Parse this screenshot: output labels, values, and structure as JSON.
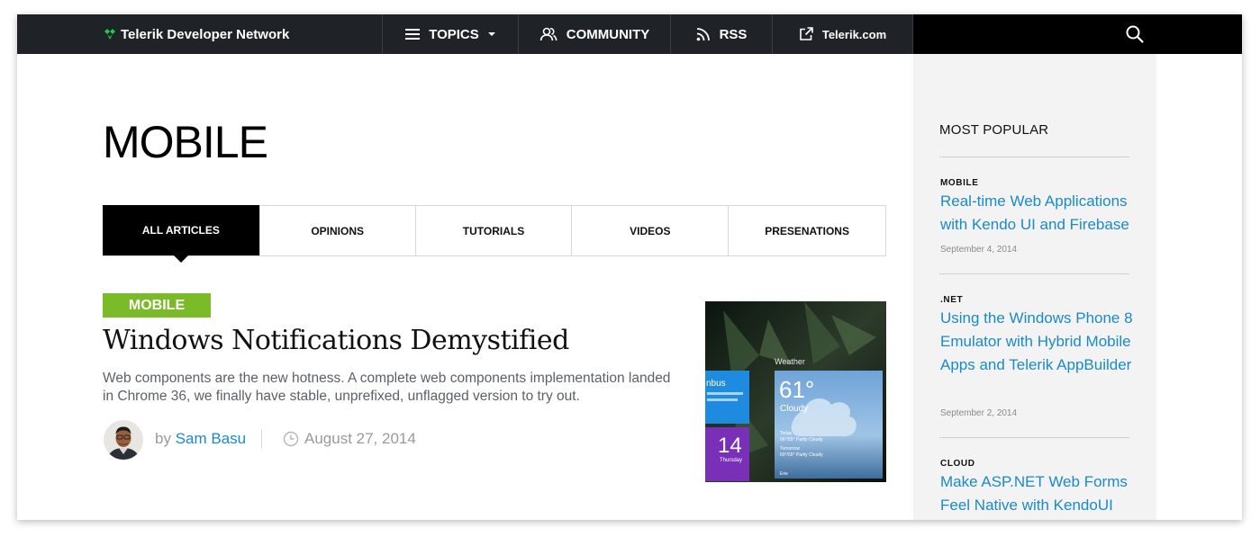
{
  "topbar": {
    "brand": "Telerik Developer Network",
    "nav": {
      "topics": "TOPICS",
      "community": "COMMUNITY",
      "rss": "RSS",
      "telerik": "Telerik.com"
    },
    "colors": {
      "bar": "#1f2227",
      "accent": "#1ec94b"
    }
  },
  "page": {
    "title": "MOBILE",
    "tabs": [
      "ALL ARTICLES",
      "OPINIONS",
      "TUTORIALS",
      "VIDEOS",
      "PRESENATIONS"
    ],
    "active_tab": "ALL ARTICLES"
  },
  "article": {
    "category": "MOBILE",
    "title": "Windows Notifications Demystified",
    "excerpt": "Web components are the new hotness. A complete web components implementation landed in Chrome 36, we finally have stable, unprefixed, unflagged version to try out.",
    "by": "by",
    "author": "Sam Basu",
    "date": "August 27, 2014",
    "thumb": {
      "weather_label": "Weather",
      "temp": "61°",
      "condition": "Cloudy",
      "tile_day": "14",
      "tile_day_label": "Thursday",
      "tile_bus": "nbus",
      "today_label": "Today",
      "today_detail": "66°/55° Partly Cloudy",
      "tomorrow_label": "Tomorrow",
      "tomorrow_detail": "69°/55° Partly Cloudy",
      "city": "Erie"
    },
    "colors": {
      "badge": "#7bbb2a",
      "link": "#1a8ac8"
    }
  },
  "sidebar": {
    "heading": "MOST POPULAR",
    "items": [
      {
        "category": "MOBILE",
        "title": "Real-time Web Applications with Kendo UI and Firebase",
        "date": "September 4, 2014"
      },
      {
        "category": ".NET",
        "title": "Using the Windows Phone 8 Emulator with Hybrid Mobile Apps and Telerik AppBuilder",
        "date": "September 2, 2014"
      },
      {
        "category": "CLOUD",
        "title": "Make ASP.NET Web Forms Feel Native with KendoUI",
        "date": ""
      }
    ]
  }
}
